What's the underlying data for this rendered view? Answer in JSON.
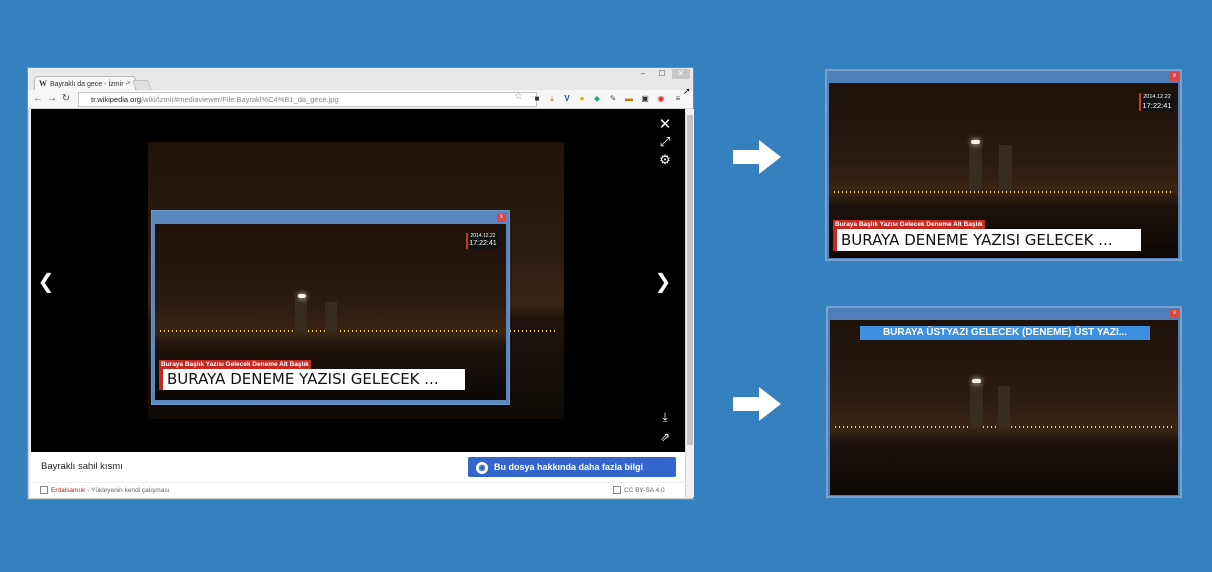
{
  "browser": {
    "tab_title": "Bayraklı da gece - İzmir -",
    "tab_favicon": "W",
    "tab_close": "×",
    "url_host": "tr.wikipedia.org",
    "url_path": "/wiki/İzmir#mediaviewer/File:Bayrakl%C4%B1_da_gece.jpg",
    "window_min": "–",
    "window_max": "☐",
    "window_close": "✕"
  },
  "viewer": {
    "close_icon": "✕",
    "fullscreen_icon": "⤢",
    "settings_icon": "⚙",
    "prev_icon": "❮",
    "next_icon": "❯",
    "download_icon": "⤓",
    "share_icon": "⇗",
    "caption": "Bayraklı sahil kısmı",
    "info_button": "Bu dosya hakkında daha fazla bilgi",
    "author": "Erdalsamuk",
    "author_suffix": " - Yükleyenin kendi çalışması",
    "license": "CC BY-SA 4.0"
  },
  "overlay": {
    "close": "x",
    "date": "2014.12.22",
    "time": "17:22:41",
    "subtitle": "Buraya Başlık Yazısı Gelecek Deneme Alt Başlık",
    "headline": "BURAYA DENEME YAZISI GELECEK ..."
  },
  "panel_top": {
    "close": "x",
    "date": "2014.12.22",
    "time": "17:22:41",
    "subtitle": "Buraya Başlık Yazısı Gelecek Deneme Alt Başlık",
    "headline": "BURAYA DENEME YAZISI GELECEK ..."
  },
  "panel_bottom": {
    "close": "x",
    "banner": "BURAYA ÜSTYAZI GELECEK (DENEME) ÜST YAZI..."
  },
  "colors": {
    "background": "#3581c0",
    "accent_red": "#c32a22",
    "button_blue": "#3366cc",
    "banner_blue": "#3d8fe0"
  }
}
